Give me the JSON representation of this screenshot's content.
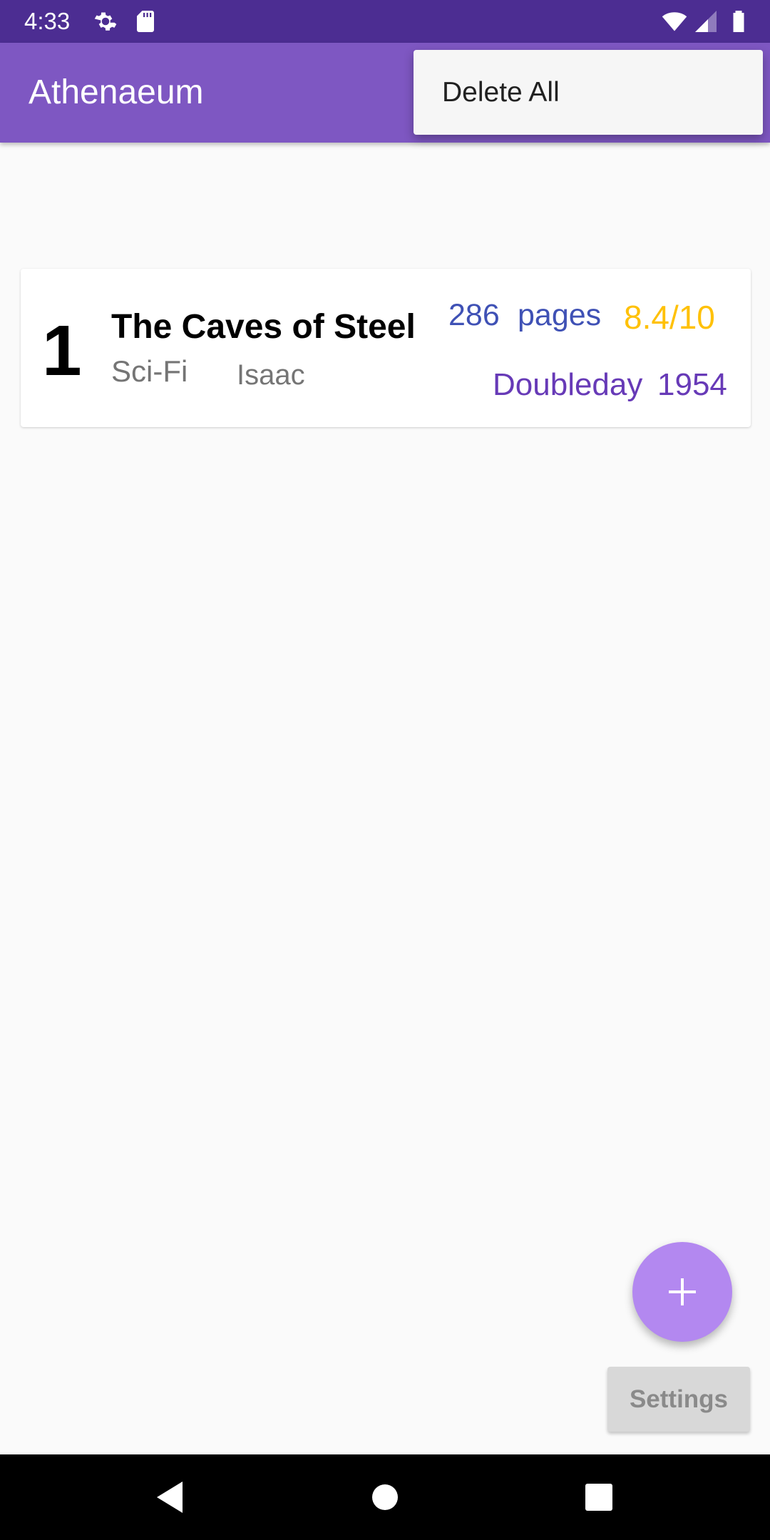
{
  "status_bar": {
    "time": "4:33",
    "icons": [
      "gear-icon",
      "sd-card-icon",
      "wifi-icon",
      "signal-icon",
      "battery-icon"
    ]
  },
  "app_bar": {
    "title": "Athenaeum"
  },
  "overflow_menu": {
    "items": [
      {
        "label": "Delete All"
      }
    ]
  },
  "books": [
    {
      "rank": "1",
      "title": "The Caves of Steel",
      "genre": "Sci-Fi",
      "author": "Isaac",
      "pages": "286",
      "pages_unit": "pages",
      "rating": "8.4/10",
      "publisher": "Doubleday",
      "year": "1954"
    }
  ],
  "fab": {
    "icon": "plus-icon"
  },
  "settings_button": {
    "label": "Settings"
  },
  "nav_bar": {
    "icons": [
      "back-icon",
      "home-icon",
      "recents-icon"
    ]
  },
  "colors": {
    "status_bar": "#4c2d92",
    "app_bar": "#7e57c2",
    "fab": "#b388f0",
    "pages": "#3f51b5",
    "rating": "#ffc107",
    "publisher": "#673ab7"
  }
}
